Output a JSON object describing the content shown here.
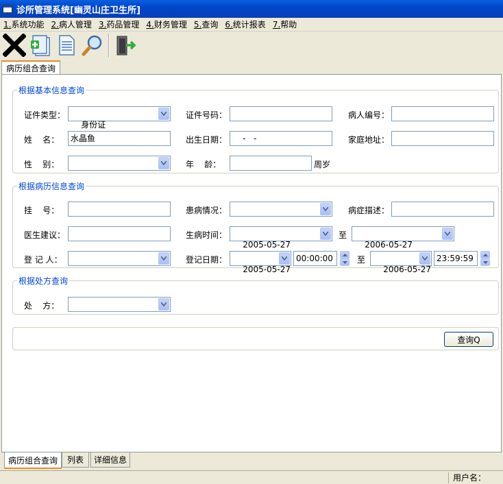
{
  "window": {
    "title": "诊所管理系统[幽灵山庄卫生所]"
  },
  "menu": [
    {
      "num": "1.",
      "label": "系统功能"
    },
    {
      "num": "2.",
      "label": "病人管理"
    },
    {
      "num": "3.",
      "label": "药品管理"
    },
    {
      "num": "4.",
      "label": "财务管理"
    },
    {
      "num": "5.",
      "label": "查询"
    },
    {
      "num": "6.",
      "label": "统计报表"
    },
    {
      "num": "7.",
      "label": "帮助"
    }
  ],
  "toolbar": {
    "buttons": [
      "close-icon",
      "new-document-icon",
      "document-icon",
      "search-icon",
      "exit-door-icon"
    ]
  },
  "top_tab": {
    "label": "病历组合查询"
  },
  "basic": {
    "legend": "根据基本信息查询",
    "id_type_label": "证件类型：",
    "id_type_value": "身份证",
    "id_no_label": "证件号码：",
    "id_no_value": "",
    "patient_no_label": "病人编号：",
    "patient_no_value": "",
    "name_label": "姓    名：",
    "name_value": "水晶鱼",
    "birth_label": "出生日期：",
    "birth_value": "    -   -",
    "address_label": "家庭地址：",
    "address_value": "",
    "gender_label": "性    别：",
    "gender_value": "",
    "age_label": "年    龄：",
    "age_value": "",
    "age_unit": "周岁"
  },
  "record": {
    "legend": "根据病历信息查询",
    "reg_label": "挂    号：",
    "reg_value": "",
    "condition_label": "患病情况：",
    "condition_value": "",
    "symptom_label": "病症描述：",
    "symptom_value": "",
    "advice_label": "医生建议：",
    "advice_value": "",
    "ill_time_label": "生病时间：",
    "ill_from": "2005-05-27",
    "to_label": "至",
    "ill_to": "2006-05-27",
    "recorder_label": "登 记 人：",
    "recorder_value": "",
    "reg_date_label": "登记日期：",
    "reg_from_date": "2005-05-27",
    "reg_from_time": "00:00:00",
    "reg_to_label": "至",
    "reg_to_date": "2006-05-27",
    "reg_to_time": "23:59:59"
  },
  "prescription": {
    "legend": "根据处方查询",
    "rx_label": "处    方：",
    "rx_value": ""
  },
  "query_button": "查询Q",
  "bottom_tabs": [
    "病历组合查询",
    "列表",
    "详细信息"
  ],
  "status": {
    "user_label": "用户名："
  }
}
